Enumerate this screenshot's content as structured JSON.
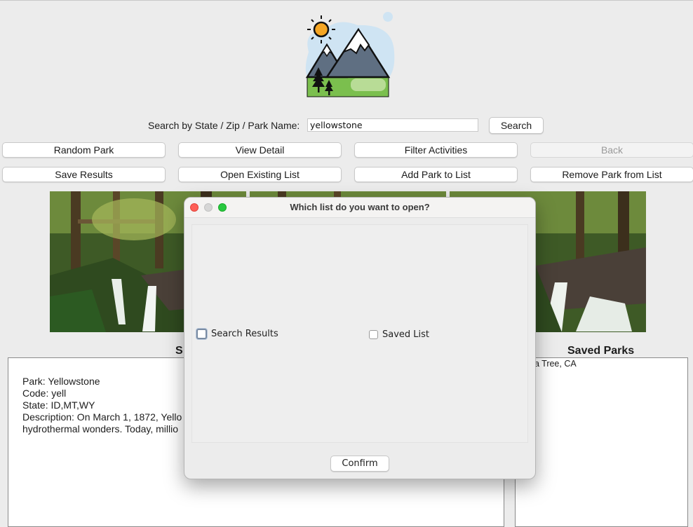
{
  "search": {
    "label": "Search by State / Zip / Park Name:",
    "value": "yellowstone",
    "button": "Search"
  },
  "buttons": {
    "row1": [
      "Random Park",
      "View Detail",
      "Filter Activities",
      "Back"
    ],
    "row2": [
      "Save Results",
      "Open Existing List",
      "Add Park to List",
      "Remove Park from List"
    ]
  },
  "left_panel": {
    "title_visible": "S",
    "lines": [
      "Park: Yellowstone",
      "Code: yell",
      "State: ID,MT,WY",
      "Description: On March 1, 1872, Yello",
      "hydrothermal wonders. Today, millio"
    ]
  },
  "saved_panel": {
    "title": "Saved Parks",
    "items": [
      "ua Tree, CA"
    ]
  },
  "dialog": {
    "title": "Which list do you want to open?",
    "options": [
      {
        "label": "Search Results",
        "checked": false
      },
      {
        "label": "Saved List",
        "checked": false
      }
    ],
    "confirm": "Confirm"
  },
  "colors": {
    "background": "#ececec",
    "close": "#fe5f57",
    "maximize": "#28c840"
  }
}
